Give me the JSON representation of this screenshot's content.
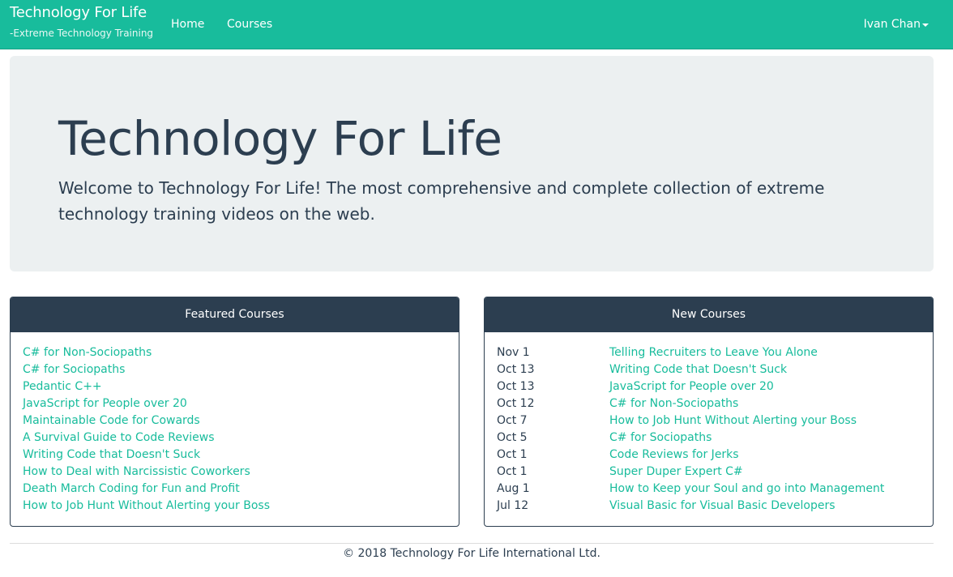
{
  "navbar": {
    "brand_title": "Technology For Life",
    "brand_subtitle": "-Extreme Technology Training",
    "links": [
      "Home",
      "Courses"
    ],
    "user": "Ivan Chan",
    "color": "#18bc9c"
  },
  "jumbotron": {
    "title": "Technology For Life",
    "lead": "Welcome to Technology For Life! The most comprehensive and complete collection of extreme technology training videos on the web."
  },
  "featured": {
    "heading": "Featured Courses",
    "courses": [
      "C# for Non-Sociopaths",
      "C# for Sociopaths",
      "Pedantic C++",
      "JavaScript for People over 20",
      "Maintainable Code for Cowards",
      "A Survival Guide to Code Reviews",
      "Writing Code that Doesn't Suck",
      "How to Deal with Narcissistic Coworkers",
      "Death March Coding for Fun and Profit",
      "How to Job Hunt Without Alerting your Boss"
    ]
  },
  "new_courses": {
    "heading": "New Courses",
    "rows": [
      {
        "date": "Nov 1",
        "title": "Telling Recruiters to Leave You Alone"
      },
      {
        "date": "Oct 13",
        "title": "Writing Code that Doesn't Suck"
      },
      {
        "date": "Oct 13",
        "title": "JavaScript for People over 20"
      },
      {
        "date": "Oct 12",
        "title": "C# for Non-Sociopaths"
      },
      {
        "date": "Oct 7",
        "title": "How to Job Hunt Without Alerting your Boss"
      },
      {
        "date": "Oct 5",
        "title": "C# for Sociopaths"
      },
      {
        "date": "Oct 1",
        "title": "Code Reviews for Jerks"
      },
      {
        "date": "Oct 1",
        "title": "Super Duper Expert C#"
      },
      {
        "date": "Aug 1",
        "title": "How to Keep your Soul and go into Management"
      },
      {
        "date": "Jul 12",
        "title": "Visual Basic for Visual Basic Developers"
      }
    ]
  },
  "footer": {
    "text": "© 2018 Technology For Life International Ltd."
  },
  "colors": {
    "primary": "#2c3e50",
    "accent": "#18bc9c",
    "jumbotron_bg": "#ecf0f1"
  }
}
